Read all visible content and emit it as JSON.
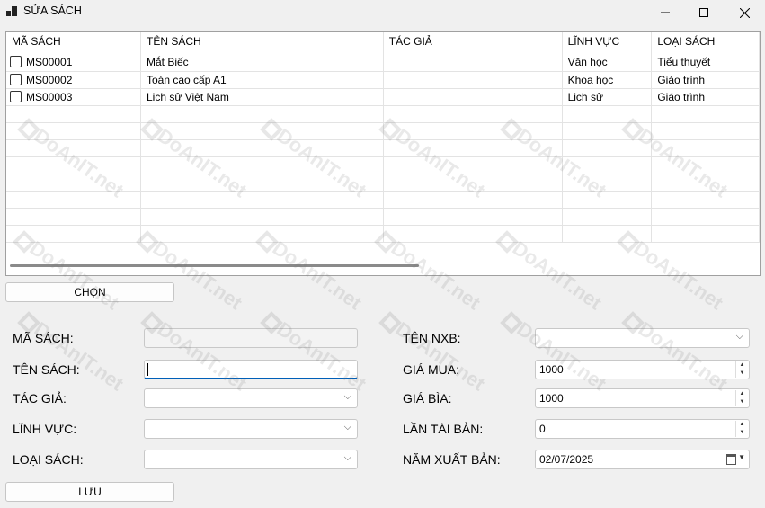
{
  "window": {
    "title": "SỬA SÁCH",
    "minimize_icon": "minimize-icon",
    "maximize_icon": "maximize-icon",
    "close_icon": "close-icon"
  },
  "grid": {
    "columns": [
      "MÃ SÁCH",
      "TÊN SÁCH",
      "TÁC GIẢ",
      "LĨNH VỰC",
      "LOẠI SÁCH"
    ],
    "rows": [
      {
        "ma": "MS00001",
        "ten": "Mắt Biếc",
        "tacgia": "",
        "linhvuc": "Văn học",
        "loai": "Tiểu thuyết",
        "checked": false
      },
      {
        "ma": "MS00002",
        "ten": "Toán cao cấp A1",
        "tacgia": "",
        "linhvuc": "Khoa học",
        "loai": "Giáo trình",
        "checked": false
      },
      {
        "ma": "MS00003",
        "ten": "Lịch sử Việt Nam",
        "tacgia": "",
        "linhvuc": "Lịch sử",
        "loai": "Giáo trình",
        "checked": false
      }
    ]
  },
  "buttons": {
    "chon": "CHỌN",
    "luu": "LƯU"
  },
  "form": {
    "ma_sach_label": "MÃ SÁCH:",
    "ten_sach_label": "TÊN SÁCH:",
    "tac_gia_label": "TÁC GIẢ:",
    "linh_vuc_label": "LĨNH VỰC:",
    "loai_sach_label": "LOẠI SÁCH:",
    "ten_nxb_label": "TÊN NXB:",
    "gia_mua_label": "GIÁ MUA:",
    "gia_bia_label": "GIÁ BÌA:",
    "lan_tai_ban_label": "LẦN TÁI BẢN:",
    "nam_xuat_ban_label": "NĂM XUẤT BẢN:",
    "ma_sach_value": "",
    "ten_sach_value": "",
    "gia_mua_value": "1000",
    "gia_bia_value": "1000",
    "lan_tai_ban_value": "0",
    "nam_xuat_ban_value": "02/07/2025"
  },
  "watermark": {
    "text": "DoAnIT.net"
  },
  "colors": {
    "focus": "#005fb8",
    "window_bg": "#f0f0f0"
  }
}
